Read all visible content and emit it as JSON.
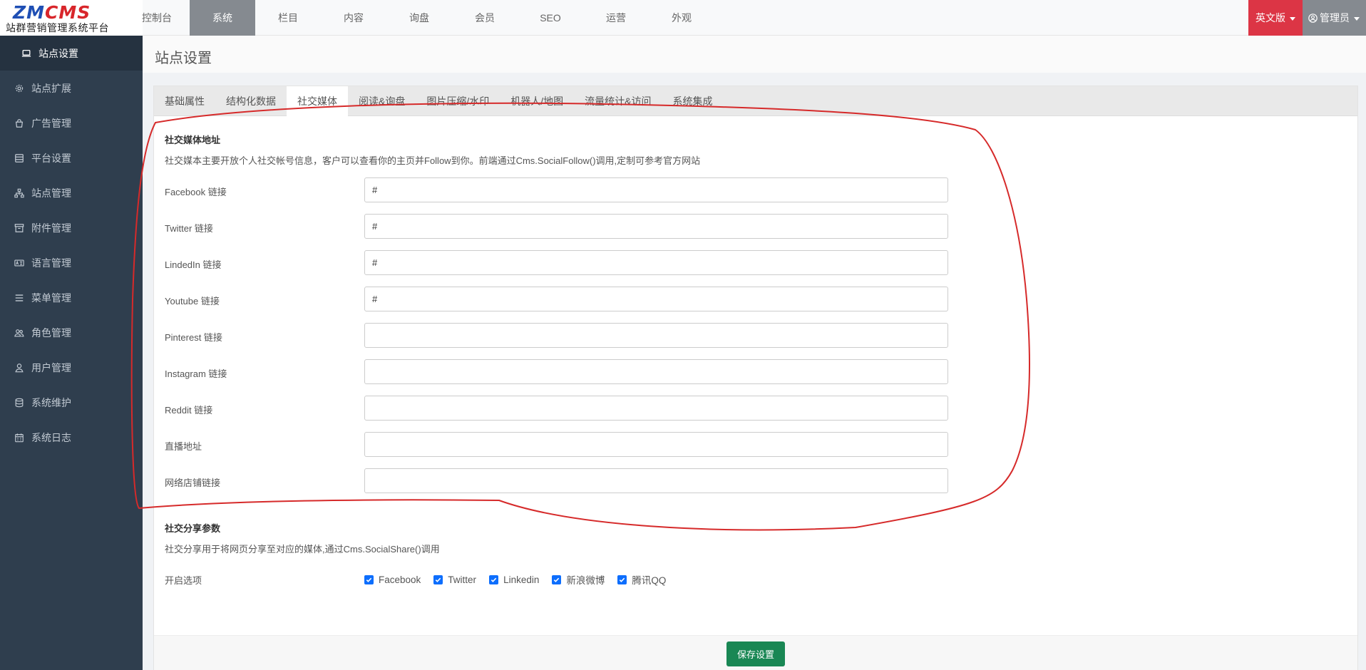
{
  "logo": {
    "mark_zm": "ZM",
    "mark_cms": "CMS",
    "subtitle": "站群营销管理系统平台"
  },
  "topnav": [
    "控制台",
    "系统",
    "栏目",
    "内容",
    "询盘",
    "会员",
    "SEO",
    "运营",
    "外观"
  ],
  "topnav_active_index": 1,
  "header": {
    "language": "英文版",
    "user": "管理员"
  },
  "sidebar": {
    "items": [
      {
        "label": "站点设置",
        "icon": "laptop-icon"
      },
      {
        "label": "站点扩展",
        "icon": "gear-icon"
      },
      {
        "label": "广告管理",
        "icon": "bag-icon"
      },
      {
        "label": "平台设置",
        "icon": "server-icon"
      },
      {
        "label": "站点管理",
        "icon": "sitemap-icon"
      },
      {
        "label": "附件管理",
        "icon": "archive-icon"
      },
      {
        "label": "语言管理",
        "icon": "language-icon"
      },
      {
        "label": "菜单管理",
        "icon": "list-icon"
      },
      {
        "label": "角色管理",
        "icon": "people-icon"
      },
      {
        "label": "用户管理",
        "icon": "person-icon"
      },
      {
        "label": "系统维护",
        "icon": "database-icon"
      },
      {
        "label": "系统日志",
        "icon": "calendar-icon"
      }
    ]
  },
  "page": {
    "title": "站点设置"
  },
  "tabs": [
    "基础属性",
    "结构化数据",
    "社交媒体",
    "阅读&询盘",
    "图片压缩/水印",
    "机器人/地图",
    "流量统计&访问",
    "系统集成"
  ],
  "tabs_active_index": 2,
  "social_media": {
    "title": "社交媒体地址",
    "description": "社交媒本主要开放个人社交帐号信息，客户可以查看你的主页并Follow到你。前端通过Cms.SocialFollow()调用,定制可参考官方网站",
    "fields": [
      {
        "label": "Facebook 链接",
        "value": "#"
      },
      {
        "label": "Twitter 链接",
        "value": "#"
      },
      {
        "label": "LindedIn 链接",
        "value": "#"
      },
      {
        "label": "Youtube 链接",
        "value": "#"
      },
      {
        "label": "Pinterest 链接",
        "value": ""
      },
      {
        "label": "Instagram 链接",
        "value": ""
      },
      {
        "label": "Reddit 链接",
        "value": ""
      },
      {
        "label": "直播地址",
        "value": ""
      },
      {
        "label": "网络店铺链接",
        "value": ""
      }
    ]
  },
  "social_share": {
    "title": "社交分享参数",
    "description": "社交分享用于将网页分享至对应的媒体,通过Cms.SocialShare()调用",
    "options_label": "开启选项",
    "options": [
      {
        "label": "Facebook",
        "checked": true
      },
      {
        "label": "Twitter",
        "checked": true
      },
      {
        "label": "Linkedin",
        "checked": true
      },
      {
        "label": "新浪微博",
        "checked": true
      },
      {
        "label": "腾讯QQ",
        "checked": true
      }
    ]
  },
  "footer": {
    "save_label": "保存设置"
  },
  "colors": {
    "sidebar_bg": "#2f3e4e",
    "active_nav": "#858a90",
    "lang_btn": "#dc3545",
    "save_btn": "#198754",
    "checkbox": "#0d6efd",
    "annotation": "#d62a2a"
  }
}
